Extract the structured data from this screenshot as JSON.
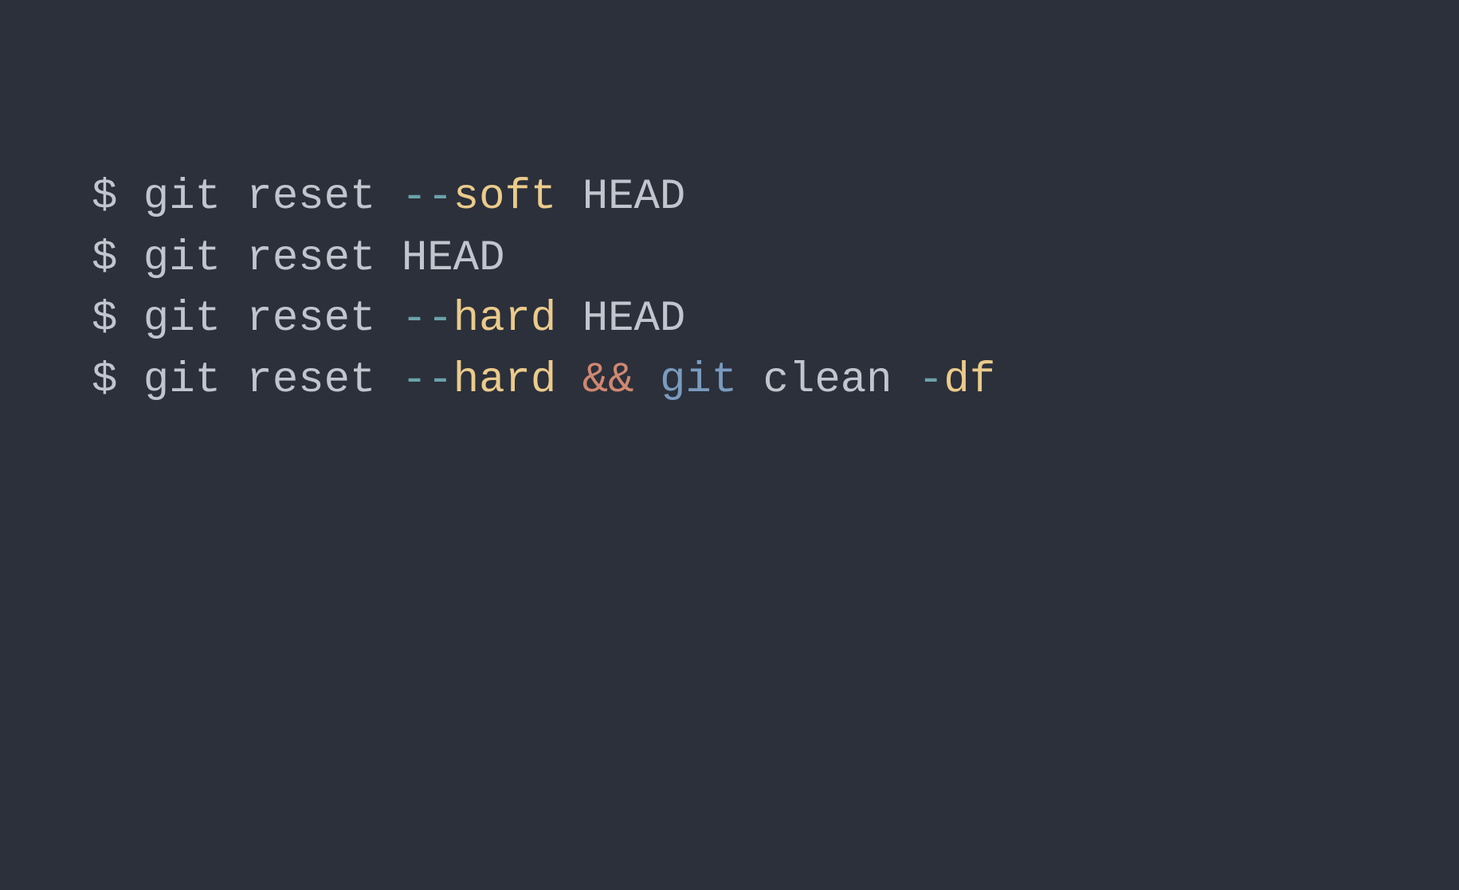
{
  "colors": {
    "background": "#2b303b",
    "default": "#c0c5ce",
    "dash": "#6ba2a9",
    "flag": "#ebcb8b",
    "operator": "#d08770",
    "keyword": "#7a9bbf"
  },
  "lines": [
    {
      "tokens": [
        {
          "text": "$ git reset ",
          "class": "tok-default"
        },
        {
          "text": "--",
          "class": "tok-dash"
        },
        {
          "text": "soft",
          "class": "tok-flag"
        },
        {
          "text": " HEAD",
          "class": "tok-default"
        }
      ]
    },
    {
      "tokens": [
        {
          "text": "$ git reset HEAD",
          "class": "tok-default"
        }
      ]
    },
    {
      "tokens": [
        {
          "text": "$ git reset ",
          "class": "tok-default"
        },
        {
          "text": "--",
          "class": "tok-dash"
        },
        {
          "text": "hard",
          "class": "tok-flag"
        },
        {
          "text": " HEAD",
          "class": "tok-default"
        }
      ]
    },
    {
      "tokens": [
        {
          "text": "$ git reset ",
          "class": "tok-default"
        },
        {
          "text": "--",
          "class": "tok-dash"
        },
        {
          "text": "hard",
          "class": "tok-flag"
        },
        {
          "text": " ",
          "class": "tok-default"
        },
        {
          "text": "&&",
          "class": "tok-op"
        },
        {
          "text": " ",
          "class": "tok-default"
        },
        {
          "text": "git",
          "class": "tok-keyword"
        },
        {
          "text": " clean ",
          "class": "tok-default"
        },
        {
          "text": "-",
          "class": "tok-dash"
        },
        {
          "text": "df",
          "class": "tok-flag"
        }
      ]
    }
  ]
}
